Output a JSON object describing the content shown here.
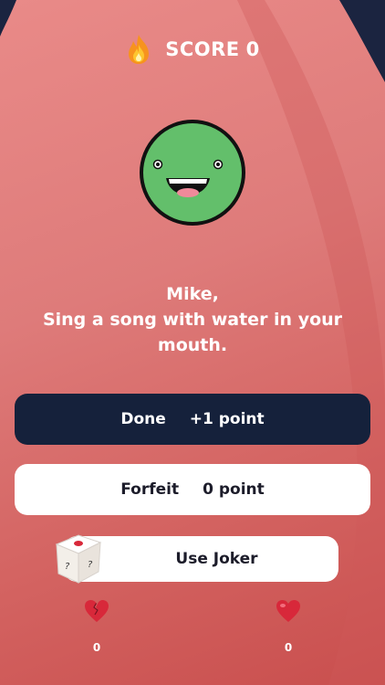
{
  "header": {
    "icon": "fire-icon",
    "score_label": "SCORE",
    "score_value": "0"
  },
  "player": {
    "avatar_icon": "smiley-face-icon",
    "avatar_color": "#63bf6b"
  },
  "prompt": {
    "name_line": "Mike,",
    "line_1": "Sing a song with water in your",
    "line_2": "mouth."
  },
  "buttons": {
    "done": {
      "label": "Done",
      "points": "+1 point"
    },
    "forfeit": {
      "label": "Forfeit",
      "points": "0 point"
    },
    "joker": {
      "label": "Use Joker",
      "icon": "dice-icon"
    }
  },
  "stats": {
    "broken_heart": {
      "icon": "broken-heart-icon",
      "count": "0"
    },
    "heart": {
      "icon": "heart-icon",
      "count": "0"
    }
  },
  "colors": {
    "background": "#de7b7a",
    "done_button": "#15213b",
    "white_button": "#ffffff",
    "heart_red": "#d8283a"
  }
}
